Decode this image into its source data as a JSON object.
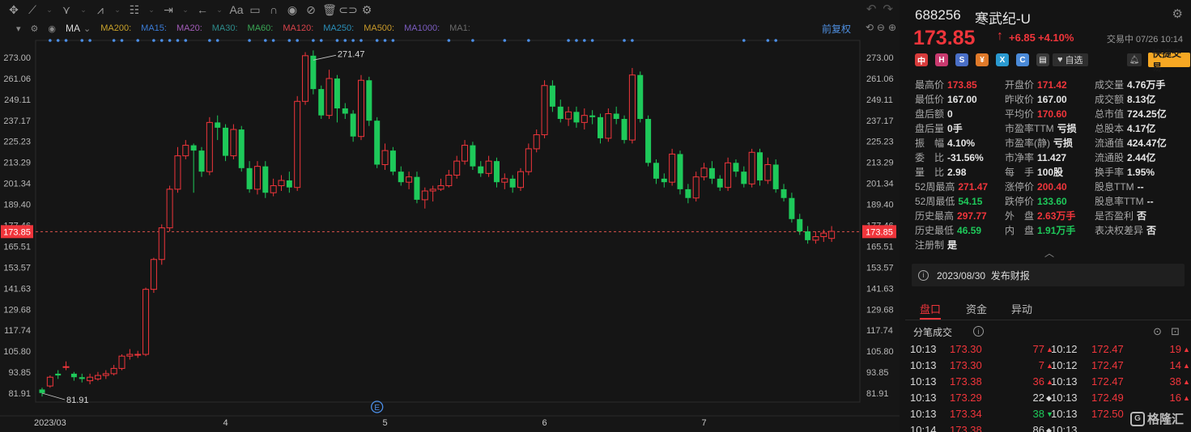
{
  "toolbar": {
    "icons": [
      "crosshair-icon",
      "line-tool-icon",
      "fork-tool-icon",
      "wave-tool-icon",
      "fib-tool-icon",
      "range-tool-icon",
      "arrow-tool-icon",
      "text-tool-icon",
      "note-tool-icon",
      "magnet-icon",
      "eye-icon",
      "hide-icon",
      "trash-icon",
      "link-icon",
      "settings-icon"
    ],
    "text_tool_label": "Aa"
  },
  "indicator_bar": {
    "main": "MA",
    "items": [
      {
        "label": "MA200:",
        "color": "#c9a22a"
      },
      {
        "label": "MA15:",
        "color": "#3a7bd5"
      },
      {
        "label": "MA20:",
        "color": "#a25cb8"
      },
      {
        "label": "MA30:",
        "color": "#2d8c8c"
      },
      {
        "label": "MA60:",
        "color": "#3aa655"
      },
      {
        "label": "MA120:",
        "color": "#d8434a"
      },
      {
        "label": "MA250:",
        "color": "#2a8fb8"
      },
      {
        "label": "MA500:",
        "color": "#c99a2a"
      },
      {
        "label": "MA1000:",
        "color": "#7b5cc0"
      },
      {
        "label": "MA1:",
        "color": "#6a6a6a"
      }
    ],
    "restore_label": "前复权"
  },
  "chart_data": {
    "type": "candlestick",
    "price_axis_ticks": [
      "273.00",
      "261.06",
      "249.11",
      "237.17",
      "225.23",
      "213.29",
      "201.34",
      "189.40",
      "177.46",
      "165.51",
      "153.57",
      "141.63",
      "129.68",
      "117.74",
      "105.80",
      "93.85",
      "81.91"
    ],
    "ylim": [
      81.91,
      273.0
    ],
    "current_price_label": "173.85",
    "current_price": 173.85,
    "high_annotation": "271.47",
    "high_value": 271.47,
    "low_annotation": "81.91",
    "low_value": 81.91,
    "x_labels": [
      {
        "label": "2023/03",
        "index": 1
      },
      {
        "label": "4",
        "index": 23
      },
      {
        "label": "5",
        "index": 43
      },
      {
        "label": "6",
        "index": 63
      },
      {
        "label": "7",
        "index": 83
      }
    ],
    "event_marker": {
      "label": "E",
      "index": 42
    },
    "signal_dots": [
      1,
      2,
      3,
      5,
      6,
      9,
      10,
      12,
      14,
      15,
      16,
      17,
      18,
      21,
      22,
      26,
      28,
      29,
      31,
      32,
      34,
      35,
      37,
      38,
      39,
      40,
      42,
      43,
      44,
      51,
      54,
      58,
      61,
      66,
      67,
      68,
      69,
      73,
      74,
      88,
      91,
      92
    ],
    "candles": [
      [
        84,
        82,
        85,
        80
      ],
      [
        86,
        91,
        92,
        85
      ],
      [
        93,
        92,
        95,
        90
      ],
      [
        97,
        97,
        100,
        95
      ],
      [
        93,
        91,
        94,
        89
      ],
      [
        91,
        90,
        93,
        88
      ],
      [
        89,
        91,
        93,
        87
      ],
      [
        90,
        92,
        94,
        89
      ],
      [
        92,
        93,
        95,
        90
      ],
      [
        93,
        96,
        98,
        92
      ],
      [
        96,
        103,
        104,
        95
      ],
      [
        103,
        104,
        107,
        101
      ],
      [
        104,
        104,
        106,
        102
      ],
      [
        104,
        141,
        142,
        103
      ],
      [
        141,
        158,
        159,
        139
      ],
      [
        158,
        176,
        178,
        155
      ],
      [
        176,
        198,
        200,
        174
      ],
      [
        198,
        217,
        222,
        196
      ],
      [
        217,
        223,
        226,
        215
      ],
      [
        223,
        220,
        224,
        196
      ],
      [
        220,
        208,
        222,
        205
      ],
      [
        208,
        236,
        239,
        206
      ],
      [
        236,
        233,
        240,
        226
      ],
      [
        233,
        217,
        235,
        214
      ],
      [
        217,
        232,
        235,
        215
      ],
      [
        232,
        210,
        234,
        208
      ],
      [
        210,
        198,
        214,
        196
      ],
      [
        198,
        211,
        214,
        195
      ],
      [
        211,
        196,
        214,
        193
      ],
      [
        196,
        200,
        204,
        194
      ],
      [
        200,
        203,
        206,
        197
      ],
      [
        203,
        199,
        208,
        196
      ],
      [
        199,
        248,
        251,
        197
      ],
      [
        248,
        274,
        276,
        246
      ],
      [
        274,
        255,
        277,
        252
      ],
      [
        255,
        240,
        257,
        238
      ],
      [
        240,
        261,
        266,
        238
      ],
      [
        261,
        244,
        263,
        236
      ],
      [
        244,
        241,
        247,
        238
      ],
      [
        241,
        228,
        243,
        225
      ],
      [
        228,
        260,
        263,
        226
      ],
      [
        260,
        237,
        262,
        234
      ],
      [
        237,
        212,
        239,
        210
      ],
      [
        212,
        220,
        224,
        209
      ],
      [
        220,
        208,
        222,
        206
      ],
      [
        208,
        202,
        211,
        200
      ],
      [
        202,
        205,
        208,
        198
      ],
      [
        205,
        192,
        208,
        190
      ],
      [
        192,
        197,
        199,
        187
      ],
      [
        197,
        198,
        200,
        191
      ],
      [
        198,
        200,
        204,
        197
      ],
      [
        200,
        206,
        209,
        199
      ],
      [
        206,
        214,
        217,
        204
      ],
      [
        214,
        223,
        226,
        212
      ],
      [
        223,
        211,
        225,
        209
      ],
      [
        211,
        207,
        214,
        205
      ],
      [
        207,
        214,
        217,
        205
      ],
      [
        214,
        202,
        216,
        199
      ],
      [
        202,
        204,
        207,
        198
      ],
      [
        204,
        199,
        206,
        196
      ],
      [
        199,
        208,
        210,
        197
      ],
      [
        208,
        221,
        224,
        206
      ],
      [
        221,
        229,
        232,
        219
      ],
      [
        229,
        257,
        260,
        227
      ],
      [
        257,
        245,
        260,
        242
      ],
      [
        245,
        238,
        249,
        236
      ],
      [
        238,
        242,
        245,
        234
      ],
      [
        242,
        236,
        245,
        233
      ],
      [
        236,
        240,
        244,
        232
      ],
      [
        240,
        239,
        243,
        235
      ],
      [
        239,
        227,
        241,
        224
      ],
      [
        227,
        241,
        244,
        225
      ],
      [
        241,
        238,
        245,
        235
      ],
      [
        238,
        226,
        240,
        224
      ],
      [
        226,
        263,
        267,
        224
      ],
      [
        263,
        238,
        265,
        236
      ],
      [
        238,
        213,
        240,
        211
      ],
      [
        213,
        204,
        215,
        201
      ],
      [
        204,
        202,
        207,
        199
      ],
      [
        202,
        218,
        221,
        200
      ],
      [
        218,
        198,
        220,
        195
      ],
      [
        198,
        193,
        201,
        190
      ],
      [
        193,
        205,
        208,
        191
      ],
      [
        205,
        210,
        213,
        203
      ],
      [
        210,
        204,
        214,
        201
      ],
      [
        204,
        199,
        206,
        197
      ],
      [
        199,
        213,
        216,
        197
      ],
      [
        213,
        208,
        215,
        205
      ],
      [
        208,
        201,
        211,
        199
      ],
      [
        201,
        219,
        221,
        199
      ],
      [
        219,
        203,
        221,
        200
      ],
      [
        203,
        212,
        216,
        201
      ],
      [
        212,
        198,
        215,
        196
      ],
      [
        198,
        193,
        201,
        191
      ],
      [
        193,
        181,
        196,
        179
      ],
      [
        181,
        174,
        184,
        172
      ],
      [
        174,
        169,
        177,
        167
      ],
      [
        169,
        171,
        174,
        167
      ],
      [
        171,
        173,
        175,
        168
      ],
      [
        170,
        174,
        177,
        168
      ]
    ]
  },
  "quote": {
    "code": "688256",
    "name": "寒武纪-U",
    "last_price": "173.85",
    "arrow": "↑",
    "change_abs": "+6.85",
    "change_pct": "+4.10%",
    "status": "交易中 07/26 10:14",
    "watchlist_label": "自选",
    "quick_trade_label": "快捷交易",
    "badges": [
      {
        "text": "中",
        "color": "#d83b3b"
      },
      {
        "text": "H",
        "color": "#c93a6f"
      },
      {
        "text": "S",
        "color": "#4a6fc7"
      },
      {
        "text": "¥",
        "color": "#e07a2a"
      },
      {
        "text": "X",
        "color": "#2a9ad1"
      },
      {
        "text": "C",
        "color": "#4a8ad8"
      },
      {
        "text": "▤",
        "color": "#3a3a3a"
      }
    ]
  },
  "stats": [
    {
      "label": "最高价",
      "value": "173.85",
      "color": "red"
    },
    {
      "label": "开盘价",
      "value": "171.42",
      "color": "red"
    },
    {
      "label": "成交量",
      "value": "4.76万手",
      "color": "white"
    },
    {
      "label": "最低价",
      "value": "167.00",
      "color": "white"
    },
    {
      "label": "昨收价",
      "value": "167.00",
      "color": "white"
    },
    {
      "label": "成交额",
      "value": "8.13亿",
      "color": "white"
    },
    {
      "label": "盘后额",
      "value": "0",
      "color": "white"
    },
    {
      "label": "平均价",
      "value": "170.60",
      "color": "red"
    },
    {
      "label": "总市值",
      "value": "724.25亿",
      "color": "white"
    },
    {
      "label": "盘后量",
      "value": "0手",
      "color": "white"
    },
    {
      "label": "市盈率TTM",
      "value": "亏损",
      "color": "white"
    },
    {
      "label": "总股本",
      "value": "4.17亿",
      "color": "white"
    },
    {
      "label": "振　幅",
      "value": "4.10%",
      "color": "white"
    },
    {
      "label": "市盈率(静)",
      "value": "亏损",
      "color": "white"
    },
    {
      "label": "流通值",
      "value": "424.47亿",
      "color": "white"
    },
    {
      "label": "委　比",
      "value": "-31.56%",
      "color": "white"
    },
    {
      "label": "市净率",
      "value": "11.427",
      "color": "white"
    },
    {
      "label": "流通股",
      "value": "2.44亿",
      "color": "white"
    },
    {
      "label": "量　比",
      "value": "2.98",
      "color": "white"
    },
    {
      "label": "每　手",
      "value": "100股",
      "color": "white"
    },
    {
      "label": "换手率",
      "value": "1.95%",
      "color": "white"
    },
    {
      "label": "52周最高",
      "value": "271.47",
      "color": "red"
    },
    {
      "label": "涨停价",
      "value": "200.40",
      "color": "red"
    },
    {
      "label": "股息TTM",
      "value": "--",
      "color": "white"
    },
    {
      "label": "52周最低",
      "value": "54.15",
      "color": "green"
    },
    {
      "label": "跌停价",
      "value": "133.60",
      "color": "green"
    },
    {
      "label": "股息率TTM",
      "value": "--",
      "color": "white"
    },
    {
      "label": "历史最高",
      "value": "297.77",
      "color": "red"
    },
    {
      "label": "外　盘",
      "value": "2.63万手",
      "color": "red"
    },
    {
      "label": "是否盈利",
      "value": "否",
      "color": "white"
    },
    {
      "label": "历史最低",
      "value": "46.59",
      "color": "green"
    },
    {
      "label": "内　盘",
      "value": "1.91万手",
      "color": "green"
    },
    {
      "label": "表决权差异",
      "value": "否",
      "color": "white"
    },
    {
      "label": "注册制",
      "value": "是",
      "color": "white"
    }
  ],
  "notice": "2023/08/30  发布财报",
  "tabs": [
    "盘口",
    "资金",
    "异动"
  ],
  "ticks_header": "分笔成交",
  "ticks": [
    {
      "l_time": "10:13",
      "l_price": "173.30",
      "l_price_color": "red",
      "l_vol": "77",
      "l_vol_color": "red",
      "l_dir": "▲",
      "l_dir_color": "red",
      "r_time": "10:12",
      "r_price": "172.47",
      "r_price_color": "red",
      "r_vol": "19",
      "r_vol_color": "red",
      "r_dir": "▲",
      "r_dir_color": "red"
    },
    {
      "l_time": "10:13",
      "l_price": "173.30",
      "l_price_color": "red",
      "l_vol": "7",
      "l_vol_color": "red",
      "l_dir": "▲",
      "l_dir_color": "red",
      "r_time": "10:12",
      "r_price": "172.47",
      "r_price_color": "red",
      "r_vol": "14",
      "r_vol_color": "red",
      "r_dir": "▲",
      "r_dir_color": "red"
    },
    {
      "l_time": "10:13",
      "l_price": "173.38",
      "l_price_color": "red",
      "l_vol": "36",
      "l_vol_color": "red",
      "l_dir": "▲",
      "l_dir_color": "red",
      "r_time": "10:13",
      "r_price": "172.47",
      "r_price_color": "red",
      "r_vol": "38",
      "r_vol_color": "red",
      "r_dir": "▲",
      "r_dir_color": "red"
    },
    {
      "l_time": "10:13",
      "l_price": "173.29",
      "l_price_color": "red",
      "l_vol": "22",
      "l_vol_color": "white",
      "l_dir": "◆",
      "l_dir_color": "white",
      "r_time": "10:13",
      "r_price": "172.49",
      "r_price_color": "red",
      "r_vol": "16",
      "r_vol_color": "red",
      "r_dir": "▲",
      "r_dir_color": "red"
    },
    {
      "l_time": "10:13",
      "l_price": "173.34",
      "l_price_color": "red",
      "l_vol": "38",
      "l_vol_color": "green",
      "l_dir": "▼",
      "l_dir_color": "green",
      "r_time": "10:13",
      "r_price": "172.50",
      "r_price_color": "red",
      "r_vol": "",
      "r_vol_color": "red",
      "r_dir": "",
      "r_dir_color": "red"
    },
    {
      "l_time": "10:14",
      "l_price": "173.38",
      "l_price_color": "red",
      "l_vol": "86",
      "l_vol_color": "white",
      "l_dir": "◆",
      "l_dir_color": "white",
      "r_time": "10:13",
      "r_price": "",
      "r_price_color": "red",
      "r_vol": "",
      "r_vol_color": "red",
      "r_dir": "",
      "r_dir_color": "red"
    }
  ],
  "watermark": "格隆汇"
}
